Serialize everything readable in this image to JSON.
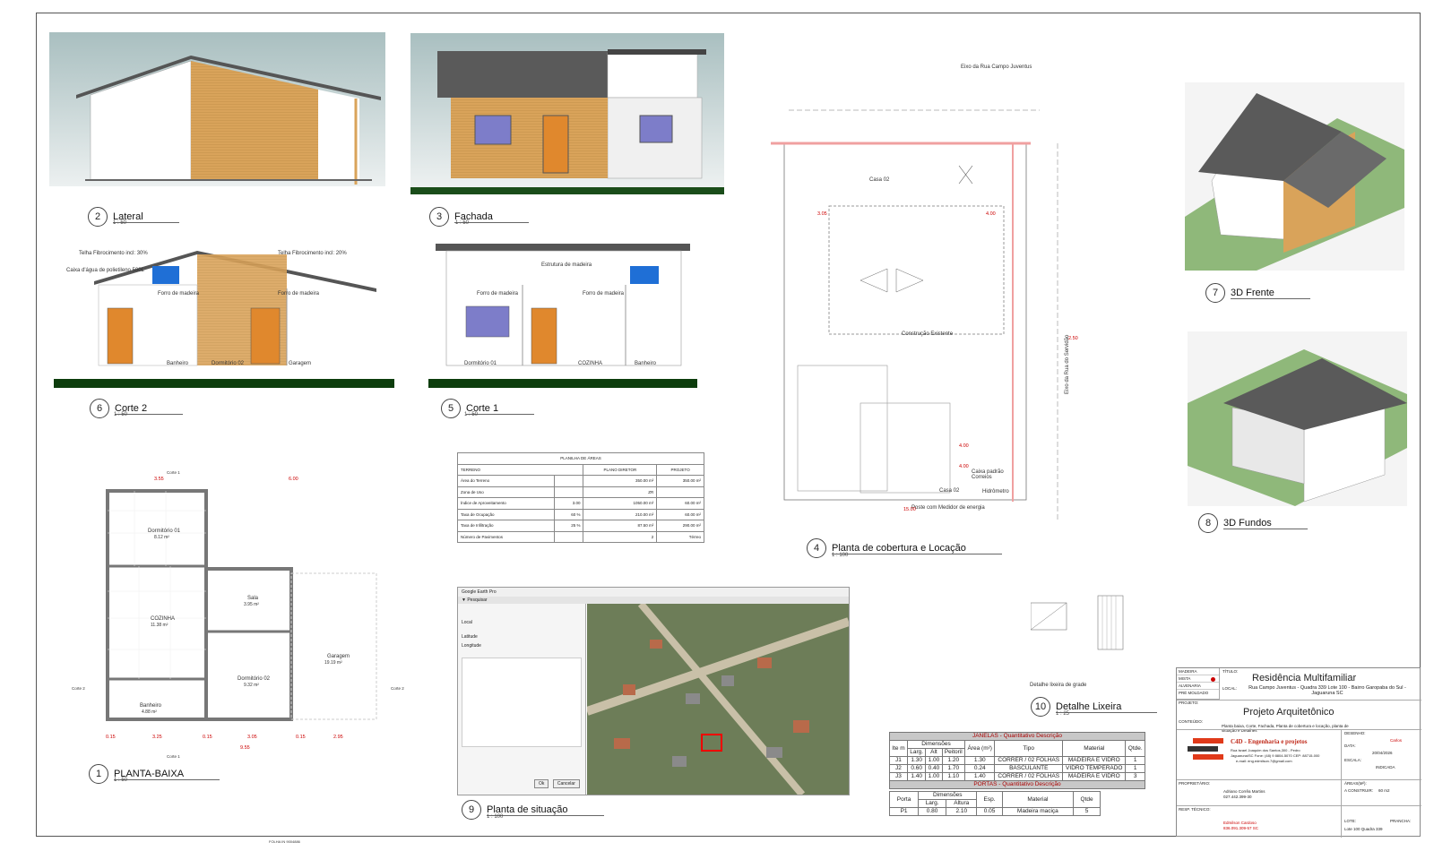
{
  "views": {
    "lateral": {
      "num": "2",
      "name": "Lateral",
      "scale": "1 : 50"
    },
    "fachada": {
      "num": "3",
      "name": "Fachada",
      "scale": "1 : 50"
    },
    "corte2": {
      "num": "6",
      "name": "Corte 2",
      "scale": "1 : 50",
      "labels": {
        "telha1": "Telha Fibrocimento incl: 30%",
        "telha2": "Telha Fibrocimento incl: 20%",
        "caixa": "Caixa d'água de polietileno 500L",
        "forro1": "Forro de madeira",
        "forro2": "Forro de madeira",
        "banheiro": "Banheiro",
        "dormitorio": "Dormitório 02",
        "garagem": "Garagem"
      }
    },
    "corte1": {
      "num": "5",
      "name": "Corte 1",
      "scale": "1 : 50",
      "labels": {
        "estrutura": "Estrutura de madeira",
        "forro1": "Forro de madeira",
        "forro2": "Forro de madeira",
        "dormitorio": "Dormitório 01",
        "cozinha": "COZINHA",
        "banheiro": "Banheiro"
      }
    },
    "planta": {
      "num": "1",
      "name": "PLANTA-BAIXA",
      "scale": "1 : 50",
      "rooms": {
        "dorm1": "Dormitório 01",
        "dorm1a": "8.12 m²",
        "sala": "Sala",
        "salaa": "3.95 m²",
        "cozinha": "COZINHA",
        "cozinhaa": "11.38 m²",
        "garagem": "Garagem",
        "garagema": "19.19 m²",
        "dorm2": "Dormitório 02",
        "dorm2a": "9.32 m²",
        "banheiro": "Banheiro",
        "banheiroa": "4.88 m²"
      },
      "dims": {
        "d355": "3.55",
        "d600": "6.00",
        "d325": "3.25",
        "d305": "3.05",
        "d295": "2.95",
        "d955": "9.55",
        "d015a": "0.15",
        "d015b": "0.15",
        "d015c": "0.15"
      },
      "cuts": {
        "c1t": "Corte 1",
        "c1b": "Corte 1",
        "c2l": "Corte 2",
        "c2r": "Corte 2"
      }
    },
    "cobertura": {
      "num": "4",
      "name": "Planta de cobertura e Locação",
      "scale": "1 : 100",
      "labels": {
        "eixo1": "Eixo da Rua Campo Juventus",
        "eixo2": "Eixo da Rua do Servidão",
        "casa02a": "Casa 02",
        "casa02b": "Casa 02",
        "existente": "Construção Existente",
        "poste": "Poste com Medidor de energia",
        "caixa": "Caixa padrão Correios",
        "hidrometro": "Hidrômetro"
      },
      "dims": {
        "d400a": "4.00",
        "d400b": "4.00",
        "d400c": "4.00",
        "d305": "3.05",
        "d1500": "15.00",
        "d250": "2.50"
      }
    },
    "situacao": {
      "num": "9",
      "name": "Planta de situação",
      "scale": "1 : 100"
    },
    "lixeira": {
      "num": "10",
      "name": "Detalhe Lixeira",
      "scale": "1 : 25",
      "caption": "Detalhe lixeira de grade"
    },
    "frente3d": {
      "num": "7",
      "name": "3D Frente"
    },
    "fundos3d": {
      "num": "8",
      "name": "3D Fundos"
    }
  },
  "areas_table": {
    "title": "PLANILHA DE ÁREAS",
    "headers": [
      "TERRENO",
      "PLANO DIRETOR",
      "PROJETO"
    ],
    "rows": [
      [
        "Área do Terreno",
        "",
        "350.00 m²",
        "350.00 m²"
      ],
      [
        "Zona de Uso",
        "",
        "ZR",
        ""
      ],
      [
        "Índice de Aproveitamento",
        "3.00",
        "1050.00 m²",
        "60.00 m²"
      ],
      [
        "Taxa de Ocupação",
        "60 %",
        "210.00 m²",
        "60.00 m²"
      ],
      [
        "Taxa de Infiltração",
        "25 %",
        "87.50 m²",
        "290.00 m²"
      ],
      [
        "Número de Pavimentos",
        "",
        "2",
        "Térreo"
      ]
    ]
  },
  "janelas": {
    "title": "JANELAS - Quantitativo Descrição",
    "head1": [
      "Ite m",
      "Dimensões",
      "Área (m²)",
      "Tipo",
      "Material",
      "Qtde."
    ],
    "head2": [
      "Larg.",
      "Alt",
      "Peitoril"
    ],
    "rows": [
      [
        "J1",
        "1.30",
        "1.00",
        "1.20",
        "1.30",
        "CORRER / 02 FOLHAS",
        "MADEIRA E VIDRO",
        "1"
      ],
      [
        "J2",
        "0.60",
        "0.40",
        "1.70",
        "0.24",
        "BASCULANTE",
        "VIDRO TEMPERADO",
        "1"
      ],
      [
        "J3",
        "1.40",
        "1.00",
        "1.10",
        "1.40",
        "CORRER / 02 FOLHAS",
        "MADEIRA E VIDRO",
        "3"
      ]
    ]
  },
  "portas": {
    "title": "PORTAS - Quantitativo Descrição",
    "head1": [
      "Porta",
      "Dimensões",
      "Esp.",
      "Material",
      "Qtde"
    ],
    "head2": [
      "Larg.",
      "Altura"
    ],
    "rows": [
      [
        "P1",
        "0.80",
        "2.10",
        "0.05",
        "Madeira maciça",
        "5"
      ]
    ]
  },
  "title_block": {
    "materials": [
      "MADEIRA",
      "MISTA",
      "ALVENARIA",
      "PRÉ MOLDADO"
    ],
    "titulo_label": "TÍTULO:",
    "titulo": "Residência Multifamiliar",
    "local_label": "LOCAL:",
    "local": "Rua Campo Juventus - Quadra 339 Lote 100 - Bairro Garopaba do Sul - Jaguaruna SC",
    "projeto_label": "PROJETO:",
    "projeto": "Projeto Arquitetônico",
    "conteudo_label": "CONTEÚDO:",
    "conteudo": "Planta baixa, Corte, Fachada, Planta de cobertura e locação, planta de situação e Detalhes",
    "desenho_label": "DESENHO:",
    "desenho": "Carlos",
    "data_label": "DATA:",
    "data": "20/04/2026",
    "escala_label": "ESCALA:",
    "escala": "INDICADA",
    "company": "C4D - Engenharia e projetos",
    "company_addr": "Rua Israel Joaquim dos Santos,300 - Pedro",
    "company_addr2": "Jaguaruna/SC  Fone: (48) 9 8804-5070 CEP: 88715-000",
    "company_email": "e-mail: eng.edmilson.7@gmail.com",
    "proprietario_label": "PROPRIETÁRIO:",
    "proprietario": "Adriano Corrêa Martins",
    "proprietario_cpf": "027.442.399-30",
    "areas_label": "ÁREAS(M²):",
    "area_construida_label": "A CONSTRUIR:",
    "area_construida": "60 m2",
    "resp_label": "RESP. TÉCNICO:",
    "resp": "Edmilson Cardoso",
    "resp_crea": "836.091.309-57 SC",
    "lote_label": "LOTE:",
    "lote": "Lote 100 Quadra 339",
    "prancha_label": "PRANCHA:",
    "folha": "FOLHA IN 9004886"
  },
  "ge": {
    "title": "Google Earth Pro",
    "menu": "▼ Pesquisar",
    "field1": "Local",
    "field2": "Latitude",
    "field3": "Longitude",
    "ok": "Ok",
    "cancel": "Cancelar"
  },
  "colors": {
    "wood": "#d9a35a",
    "roof": "#555",
    "ground": "#1a4d1a",
    "dim": "#cc0000"
  }
}
